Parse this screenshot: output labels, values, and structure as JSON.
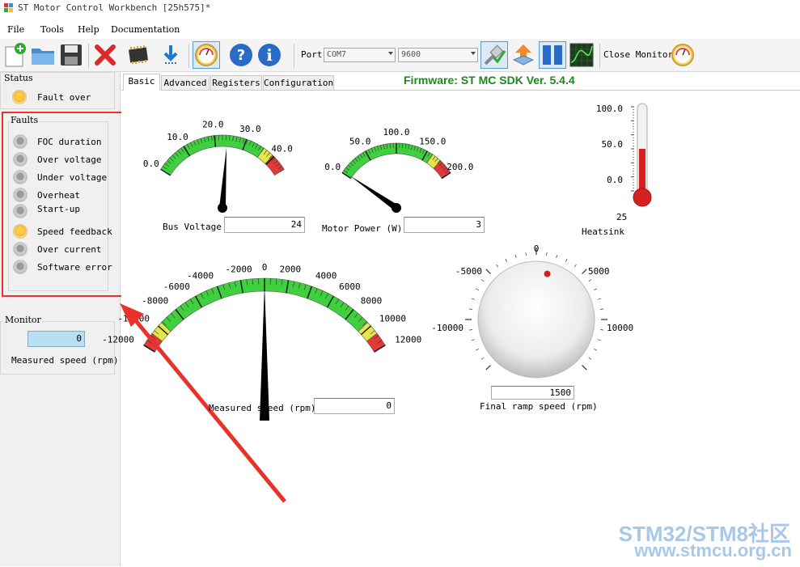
{
  "window": {
    "title": "ST Motor Control Workbench [25h575]*"
  },
  "menu": {
    "file": "File",
    "tools": "Tools",
    "help": "Help",
    "documentation": "Documentation"
  },
  "toolbar": {
    "port_label": "Port",
    "port_value": "COM7",
    "baud_value": "9600",
    "close_monitor_label": "Close Monitor",
    "icons": [
      "new-project-icon",
      "open-folder-icon",
      "save-icon",
      "delete-icon",
      "chip-icon",
      "download-icon",
      "monitor-gauge-icon",
      "help-icon",
      "info-icon",
      "connect-icon",
      "upload-icon",
      "pause-icon",
      "scope-icon",
      "gauge-icon"
    ]
  },
  "status": {
    "title": "Status",
    "items": [
      {
        "label": "Fault over",
        "state": "orange"
      }
    ]
  },
  "faults": {
    "title": "Faults",
    "items": [
      {
        "label": "FOC duration",
        "state": "grey"
      },
      {
        "label": "Over voltage",
        "state": "grey"
      },
      {
        "label": "Under voltage",
        "state": "grey"
      },
      {
        "label": "Overheat",
        "state": "grey"
      },
      {
        "label": "Start-up",
        "state": "grey"
      },
      {
        "label": "Speed feedback",
        "state": "orange"
      },
      {
        "label": "Over current",
        "state": "grey"
      },
      {
        "label": "Software error",
        "state": "grey"
      }
    ]
  },
  "monitor": {
    "title": "Monitor",
    "value": "0",
    "label": "Measured speed (rpm)"
  },
  "tabs": [
    "Basic",
    "Advanced",
    "Registers",
    "Configuration"
  ],
  "firmware": "Firmware: ST MC SDK Ver. 5.4.4",
  "gauges": {
    "bus_voltage": {
      "label": "Bus Voltage",
      "value_text": "24",
      "value": 24,
      "min": 0,
      "max": 45,
      "ticks": [
        "0.0",
        "10.0",
        "20.0",
        "30.0",
        "40.0"
      ],
      "tick_values": [
        0,
        10,
        20,
        30,
        40
      ]
    },
    "motor_power": {
      "label": "Motor Power (W)",
      "value_text": "3",
      "value": 3,
      "min": 0,
      "max": 200,
      "ticks": [
        "0.0",
        "50.0",
        "100.0",
        "150.0",
        "200.0"
      ],
      "tick_values": [
        0,
        50,
        100,
        150,
        200
      ]
    },
    "heatsink": {
      "label": "Heatsink",
      "value_text": "25",
      "value": 25,
      "ticks": [
        "100.0",
        "50.0",
        "0.0"
      ]
    },
    "measured_speed": {
      "label": "Measured speed (rpm)",
      "value_text": "0",
      "value": 0,
      "ticks": [
        "-12000",
        "-10000",
        "-8000",
        "-6000",
        "-4000",
        "-2000",
        "0",
        "2000",
        "4000",
        "6000",
        "8000",
        "10000",
        "12000"
      ],
      "tick_values": [
        -12000,
        -10000,
        -8000,
        -6000,
        -4000,
        -2000,
        0,
        2000,
        4000,
        6000,
        8000,
        10000,
        12000
      ]
    },
    "final_ramp": {
      "label": "Final ramp speed (rpm)",
      "value_text": "1500",
      "value": 1500,
      "ticks": [
        "0",
        "5000",
        "10000",
        "-5000",
        "-10000"
      ]
    }
  },
  "watermark": {
    "line1": "STM32/STM8社区",
    "line2": "www.stmcu.org.cn"
  },
  "colors": {
    "firmware": "#1a8a1a",
    "highlight": "#e8322a",
    "gauge_green": "#3fcf3f",
    "gauge_yellow": "#e6e64a",
    "gauge_red": "#e03a3a"
  }
}
